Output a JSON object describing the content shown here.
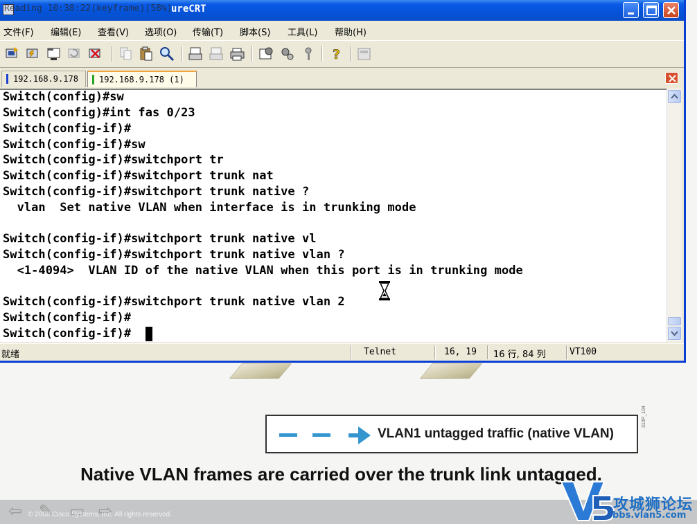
{
  "window": {
    "title": "SecureCRT",
    "title_overlay": "Reading 10:38:22(keyframe)(58%)",
    "title_visible": "ureCRT"
  },
  "menu": [
    {
      "label": "文件(F)"
    },
    {
      "label": "编辑(E)"
    },
    {
      "label": "查看(V)"
    },
    {
      "label": "选项(O)"
    },
    {
      "label": "传输(T)"
    },
    {
      "label": "脚本(S)"
    },
    {
      "label": "工具(L)"
    },
    {
      "label": "帮助(H)"
    }
  ],
  "toolbar": {
    "icons": [
      "connect-icon",
      "quick-connect-icon",
      "connect-in-tab-icon",
      "reconnect-icon",
      "disconnect-icon",
      "copy-icon",
      "paste-icon",
      "find-icon",
      "print-icon",
      "print-selection-icon",
      "printer-icon",
      "session-options-icon",
      "global-options-icon",
      "keymap-icon",
      "help-icon",
      "sftp-icon"
    ]
  },
  "tabs": [
    {
      "label": "192.168.9.178",
      "mark_color": "#1a3fd0",
      "active": false
    },
    {
      "label": "192.168.9.178 (1)",
      "mark_color": "#2aa52a",
      "active": true
    }
  ],
  "terminal": {
    "lines": [
      "Switch(config)#sw",
      "Switch(config)#int fas 0/23",
      "Switch(config-if)#",
      "Switch(config-if)#sw",
      "Switch(config-if)#switchport tr",
      "Switch(config-if)#switchport trunk nat",
      "Switch(config-if)#switchport trunk native ?",
      "  vlan  Set native VLAN when interface is in trunking mode",
      "",
      "Switch(config-if)#switchport trunk native vl",
      "Switch(config-if)#switchport trunk native vlan ?",
      "  <1-4094>  VLAN ID of the native VLAN when this port is in trunking mode",
      "",
      "Switch(config-if)#switchport trunk native vlan 2",
      "Switch(config-if)#",
      "Switch(config-if)#"
    ]
  },
  "status": {
    "ready": "就绪",
    "protocol": "Telnet",
    "cursor_pos": "16, 19",
    "rows_cols": "16 行, 84 列",
    "emulation": "VT100"
  },
  "slide": {
    "legend_text": "VLAN1 untagged traffic (native VLAN)",
    "legend_color": "#3596cf",
    "code": "310P_104",
    "caption": "Native VLAN frames are carried over the trunk link untagged.",
    "copyright": "© 2006 Cisco Systems, Inc. All rights reserved.",
    "watermark_title": "攻城狮论坛",
    "watermark_url": "bbs.vlan5.com"
  }
}
